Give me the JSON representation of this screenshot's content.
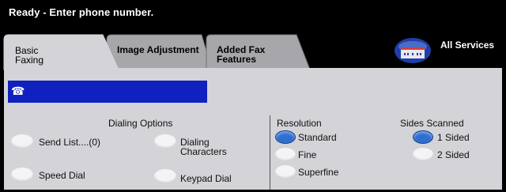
{
  "status": "Ready - Enter phone number.",
  "tabs": [
    {
      "label": "Basic\nFaxing"
    },
    {
      "label": "Image Adjustment"
    },
    {
      "label": "Added Fax\nFeatures"
    }
  ],
  "all_services": {
    "label": "All Services"
  },
  "phone_field": {
    "value": "",
    "icon": "telephone-icon"
  },
  "dialing_options": {
    "title": "Dialing Options",
    "buttons": [
      {
        "label": "Send List....(0)"
      },
      {
        "label": "Dialing\nCharacters"
      },
      {
        "label": "Speed Dial"
      },
      {
        "label": "Keypad Dial"
      }
    ]
  },
  "resolution": {
    "title": "Resolution",
    "options": [
      {
        "label": "Standard",
        "selected": true
      },
      {
        "label": "Fine",
        "selected": false
      },
      {
        "label": "Superfine",
        "selected": false
      }
    ]
  },
  "sides_scanned": {
    "title": "Sides Scanned",
    "options": [
      {
        "label": "1 Sided",
        "selected": true
      },
      {
        "label": "2 Sided",
        "selected": false
      }
    ]
  },
  "colors": {
    "field": "#0f22bf",
    "selected": "#2f6fd0",
    "panel": "#d3d3d8",
    "tab_inactive": "#a7a7ab"
  }
}
